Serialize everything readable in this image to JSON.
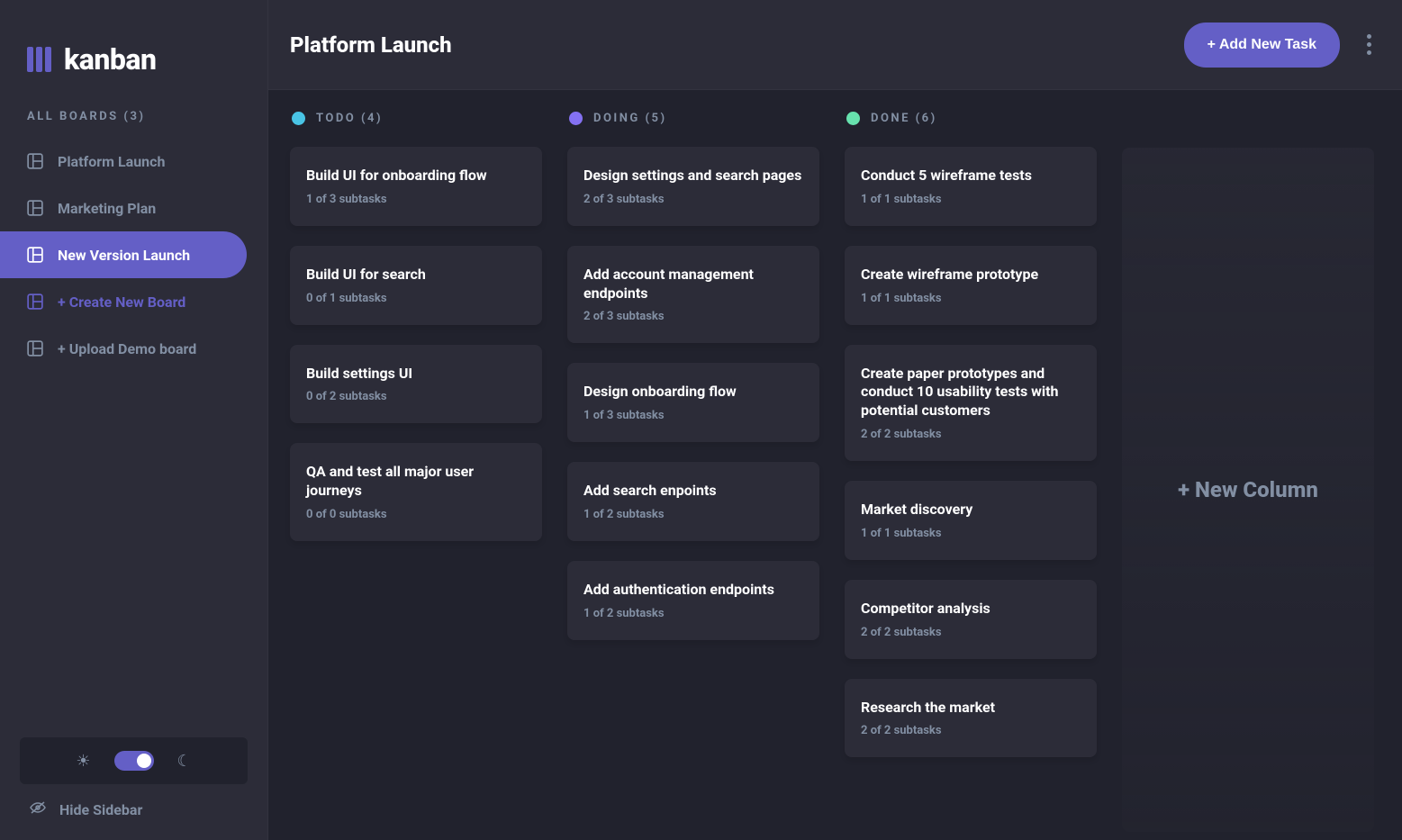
{
  "logo": {
    "text": "kanban"
  },
  "sidebar": {
    "boards_label": "ALL BOARDS (3)",
    "items": [
      {
        "label": "Platform Launch"
      },
      {
        "label": "Marketing Plan"
      },
      {
        "label": "New Version Launch"
      }
    ],
    "create_label": "+ Create New Board",
    "upload_label": "+ Upload Demo board",
    "hide_label": "Hide Sidebar"
  },
  "header": {
    "title": "Platform Launch",
    "add_task_label": "+ Add New Task"
  },
  "columns": [
    {
      "name": "TODO",
      "label": "TODO (4)",
      "color": "#49c4e5",
      "cards": [
        {
          "title": "Build UI for onboarding flow",
          "sub": "1 of 3 subtasks"
        },
        {
          "title": "Build UI for search",
          "sub": "0 of 1 subtasks"
        },
        {
          "title": "Build settings UI",
          "sub": "0 of 2 subtasks"
        },
        {
          "title": "QA and test all major user journeys",
          "sub": "0 of 0 subtasks"
        }
      ]
    },
    {
      "name": "DOING",
      "label": "DOING (5)",
      "color": "#8471f2",
      "cards": [
        {
          "title": "Design settings and search pages",
          "sub": "2 of 3 subtasks"
        },
        {
          "title": "Add account management endpoints",
          "sub": "2 of 3 subtasks"
        },
        {
          "title": "Design onboarding flow",
          "sub": "1 of 3 subtasks"
        },
        {
          "title": "Add search enpoints",
          "sub": "1 of 2 subtasks"
        },
        {
          "title": "Add authentication endpoints",
          "sub": "1 of 2 subtasks"
        }
      ]
    },
    {
      "name": "DONE",
      "label": "DONE (6)",
      "color": "#67e2ae",
      "cards": [
        {
          "title": "Conduct 5 wireframe tests",
          "sub": "1 of 1 subtasks"
        },
        {
          "title": "Create wireframe prototype",
          "sub": "1 of 1 subtasks"
        },
        {
          "title": "Create paper prototypes and conduct 10 usability tests with potential customers",
          "sub": "2 of 2 subtasks"
        },
        {
          "title": "Market discovery",
          "sub": "1 of 1 subtasks"
        },
        {
          "title": "Competitor analysis",
          "sub": "2 of 2 subtasks"
        },
        {
          "title": "Research the market",
          "sub": "2 of 2 subtasks"
        }
      ]
    }
  ],
  "new_column_label": "+ New Column"
}
